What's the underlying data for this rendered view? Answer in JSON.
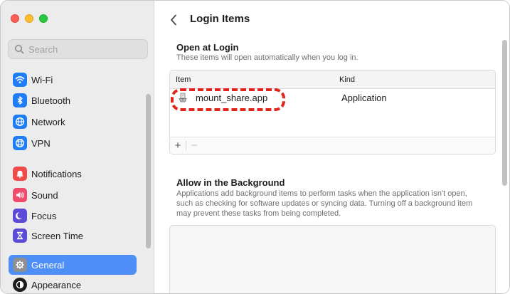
{
  "window": {
    "controls": [
      "close",
      "minimize",
      "zoom"
    ]
  },
  "search": {
    "placeholder": "Search",
    "value": ""
  },
  "sidebar": {
    "items": [
      {
        "label": "Wi-Fi",
        "icon": "wifi-icon",
        "color": "#1f7ef5",
        "selected": false
      },
      {
        "label": "Bluetooth",
        "icon": "bluetooth-icon",
        "color": "#1f7ef5",
        "selected": false
      },
      {
        "label": "Network",
        "icon": "globe-icon",
        "color": "#1f7ef5",
        "selected": false
      },
      {
        "label": "VPN",
        "icon": "vpn-globe-icon",
        "color": "#1f7ef5",
        "selected": false
      },
      {
        "label": "Notifications",
        "icon": "bell-icon",
        "color": "#ef4b4b",
        "selected": false
      },
      {
        "label": "Sound",
        "icon": "speaker-icon",
        "color": "#ef4b6a",
        "selected": false
      },
      {
        "label": "Focus",
        "icon": "moon-icon",
        "color": "#5b4bd6",
        "selected": false
      },
      {
        "label": "Screen Time",
        "icon": "hourglass-icon",
        "color": "#5b4bd6",
        "selected": false
      },
      {
        "label": "General",
        "icon": "gear-icon",
        "color": "#8e8e93",
        "selected": true
      },
      {
        "label": "Appearance",
        "icon": "appearance-icon",
        "color": "#1d1d1f",
        "selected": false
      }
    ]
  },
  "header": {
    "title": "Login Items",
    "back_icon": "chevron-left-icon"
  },
  "open_at_login": {
    "title": "Open at Login",
    "description": "These items will open automatically when you log in.",
    "columns": {
      "item": "Item",
      "kind": "Kind"
    },
    "rows": [
      {
        "item": "mount_share.app",
        "kind": "Application",
        "icon": "script-app-icon"
      }
    ],
    "add_label": "+",
    "remove_label": "−"
  },
  "background": {
    "title": "Allow in the Background",
    "description": "Applications add background items to perform tasks when the application isn't open, such as checking for software updates or syncing data. Turning off a background item may prevent these tasks from being completed."
  },
  "colors": {
    "accent": "#4d8ef7",
    "highlight": "#e0251b"
  }
}
